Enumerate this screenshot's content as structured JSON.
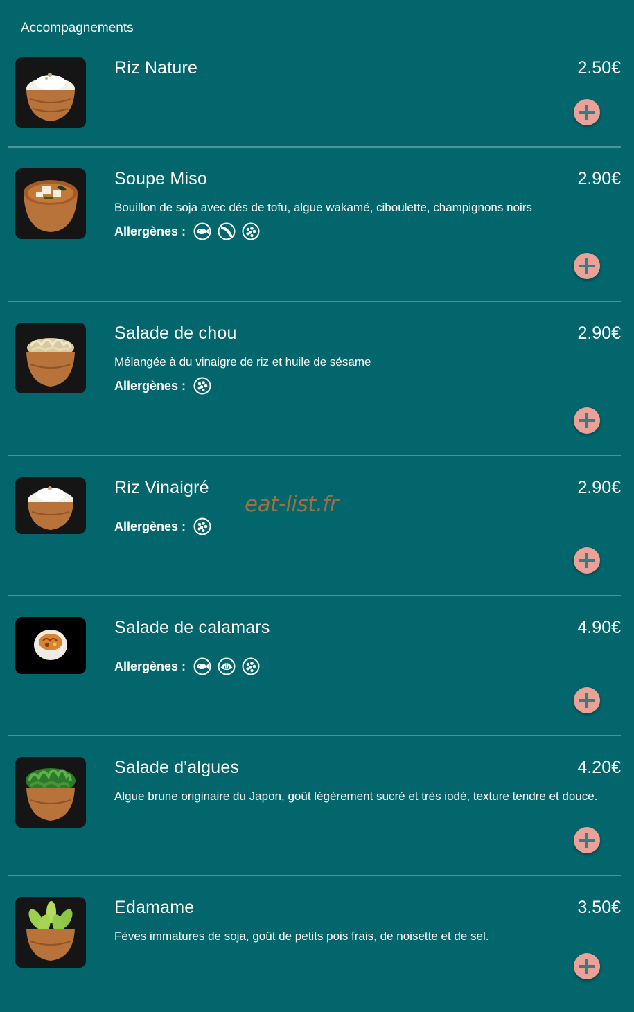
{
  "section": {
    "title": "Accompagnements"
  },
  "allergens_label": "Allergènes :",
  "watermark": "eat-list.fr",
  "colors": {
    "background": "#02666c",
    "divider": "#4d9497",
    "add_button": "#e9a198",
    "plus_icon": "#3c7c80"
  },
  "items": [
    {
      "name": "Riz Nature",
      "price": "2.50€",
      "description": "",
      "allergens": [],
      "image": "rice-bowl"
    },
    {
      "name": "Soupe Miso",
      "price": "2.90€",
      "description": "Bouillon de soja avec dés de tofu, algue wakamé, ciboulette, champignons noirs",
      "allergens": [
        "fish-icon",
        "crustacean-icon",
        "soy-icon"
      ],
      "image": "miso-soup"
    },
    {
      "name": "Salade de chou",
      "price": "2.90€",
      "description": "Mélangée à du vinaigre de riz et huile de sésame",
      "allergens": [
        "soy-icon"
      ],
      "image": "cabbage-salad"
    },
    {
      "name": "Riz Vinaigré",
      "price": "2.90€",
      "description": "",
      "allergens": [
        "soy-icon"
      ],
      "image": "rice-bowl"
    },
    {
      "name": "Salade de calamars",
      "price": "4.90€",
      "description": "",
      "allergens": [
        "fish-icon",
        "shellfish-icon",
        "soy-icon"
      ],
      "image": "calamari-salad"
    },
    {
      "name": "Salade d'algues",
      "price": "4.20€",
      "description": "Algue brune originaire du Japon, goût légèrement sucré et très iodé, texture tendre et douce.",
      "allergens": [],
      "image": "seaweed-salad"
    },
    {
      "name": "Edamame",
      "price": "3.50€",
      "description": "Fèves immatures de soja, goût de petits pois frais, de noisette et de sel.",
      "allergens": [],
      "image": "edamame"
    }
  ]
}
